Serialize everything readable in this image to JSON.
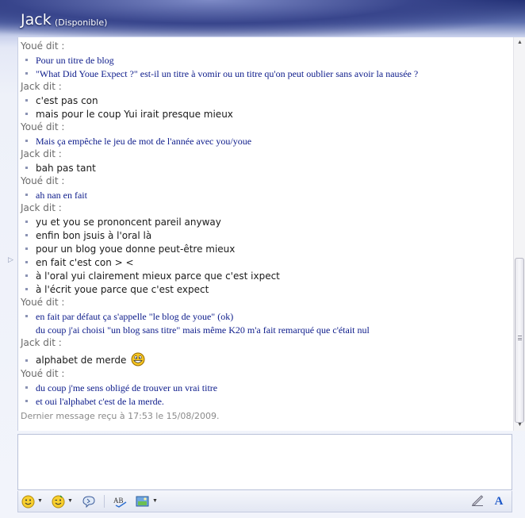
{
  "window": {
    "contact_name": "Jack",
    "contact_status": "(Disponible)"
  },
  "conversation": {
    "groups": [
      {
        "sender": "Youé dit :",
        "side": "you",
        "lines": [
          "Pour un titre de blog",
          "\"What Did Youe Expect ?\" est-il un titre à vomir ou un titre qu'on peut oublier sans avoir la nausée ?"
        ]
      },
      {
        "sender": "Jack dit :",
        "side": "jack",
        "lines": [
          "c'est pas con",
          "mais pour le coup Yui irait presque mieux"
        ]
      },
      {
        "sender": "Youé dit :",
        "side": "you",
        "lines": [
          "Mais ça empêche le jeu de mot de l'année avec you/youe"
        ]
      },
      {
        "sender": "Jack dit :",
        "side": "jack",
        "lines": [
          "bah pas tant"
        ]
      },
      {
        "sender": "Youé dit :",
        "side": "you",
        "lines": [
          "ah nan en fait"
        ]
      },
      {
        "sender": "Jack dit :",
        "side": "jack",
        "lines": [
          "yu et you se prononcent pareil anyway",
          "enfin bon jsuis à l'oral là",
          "pour un blog youe donne peut-être mieux",
          "en fait c'est con > <",
          "à l'oral yui clairement mieux parce que c'est ixpect",
          "à l'écrit youe parce que c'est expect"
        ]
      },
      {
        "sender": "Youé dit :",
        "side": "you",
        "lines": [
          "en fait par défaut ça s'appelle \"le blog de youe\" (ok)",
          "du coup j'ai choisi \"un blog sans titre\" mais même K20 m'a fait remarqué que c'était nul"
        ],
        "continuation_index": 1
      },
      {
        "sender": "Jack dit :",
        "side": "jack",
        "lines": [
          "alphabet de merde"
        ],
        "emoticon": "grinning-smiley-icon"
      },
      {
        "sender": "Youé dit :",
        "side": "you",
        "lines": [
          "du coup j'me sens obligé de trouver un vrai titre",
          "et oui l'alphabet c'est de la merde."
        ]
      }
    ],
    "last_message": "Dernier message reçu à 17:53 le 15/08/2009."
  },
  "input": {
    "value": ""
  },
  "toolbar": {
    "icons": [
      "emoticon-icon",
      "wink-icon",
      "nudge-icon",
      "spellcheck-icon",
      "background-icon",
      "handwriting-icon",
      "font-icon"
    ]
  },
  "colors": {
    "title_bar": "#1c2a6e",
    "you_text": "#0b1a8a",
    "jack_text": "#1a1a1a",
    "sender_text": "#6b6b6b"
  }
}
